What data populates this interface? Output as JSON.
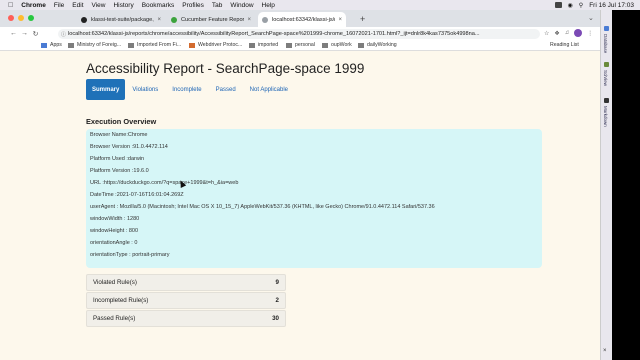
{
  "menubar": {
    "app": "Chrome",
    "menus": [
      "File",
      "Edit",
      "View",
      "History",
      "Bookmarks",
      "Profiles",
      "Tab",
      "Window",
      "Help"
    ],
    "clock": "Fri 16 Jul 17:03"
  },
  "browser": {
    "tabs": [
      {
        "title": "klassi-test-suite/package.json",
        "active": false
      },
      {
        "title": "Cucumber Feature Report",
        "active": false
      },
      {
        "title": "localhost:63342/klassi-js/repo",
        "active": true
      }
    ],
    "url": "localhost:63342/klassi-js/reports/chrome/accessibility/AccessibilityReport_SearchPage-space%201999-chrome_16072021-1701.html?_ijt=dnlr8k4kas7375ok4998na...",
    "bookmarks": [
      "Apps",
      "Ministry of Foreig...",
      "Imported From Fi...",
      "Webdriver Protoc...",
      "imported",
      "personal",
      "oupWork",
      "dailyWorking"
    ],
    "reading_list": "Reading List"
  },
  "report": {
    "title": "Accessibility Report - SearchPage-space 1999",
    "tabs": [
      "Summary",
      "Violations",
      "Incomplete",
      "Passed",
      "Not Applicable"
    ],
    "active_tab": "Summary",
    "execution_heading": "Execution Overview",
    "execution_lines": [
      "Browser Name:Chrome",
      "Browser Version :91.0.4472.114",
      "Platform Used :darwin",
      "Platform Version :19.6.0",
      "URL :https://duckduckgo.com/?q=space+1999&t=h_&ia=web",
      "DateTime :2021-07-16T16:01:04.269Z",
      "userAgent : Mozilla/5.0 (Macintosh; Intel Mac OS X 10_15_7) AppleWebKit/537.36 (KHTML, like Gecko) Chrome/91.0.4472.114 Safari/537.36",
      "windowWidth : 1280",
      "windowHeight : 800",
      "orientationAngle : 0",
      "orientationType : portrait-primary"
    ],
    "rules": [
      {
        "label": "Violated Rule(s)",
        "count": "9"
      },
      {
        "label": "Incompleted Rule(s)",
        "count": "2"
      },
      {
        "label": "Passed Rule(s)",
        "count": "30"
      }
    ]
  },
  "side_panel": [
    "Database",
    "SciView",
    "Markdown"
  ],
  "colors": {
    "page_bg": "#fdf8ec",
    "accent": "#1f71b8",
    "exec_box": "#d6f6f7"
  }
}
